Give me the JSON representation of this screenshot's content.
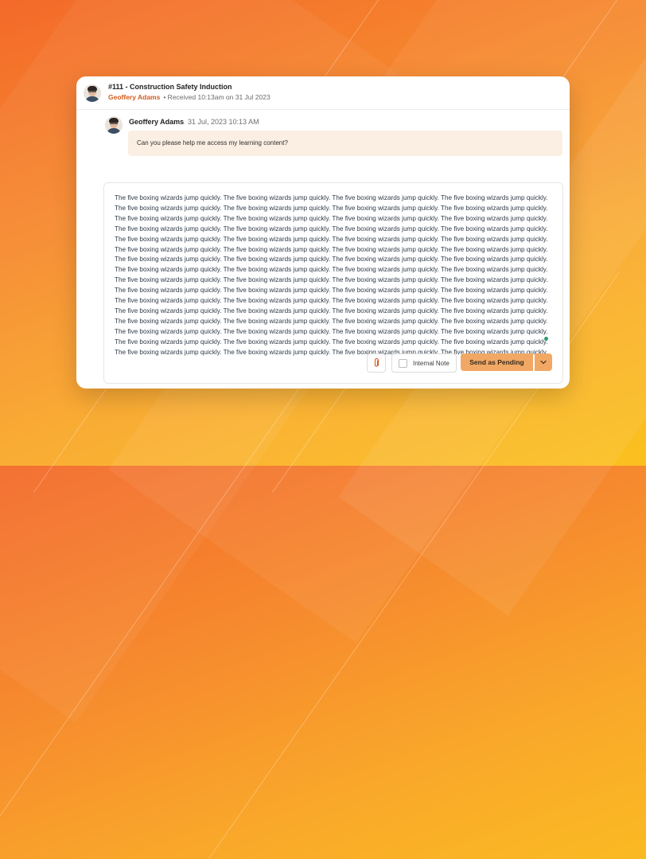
{
  "ticket": {
    "title": "#111 - Construction Safety Induction",
    "sender": "Geoffery Adams",
    "received": "• Received 10:13am on 31 Jul 2023"
  },
  "message": {
    "author": "Geoffery Adams",
    "time": "31 Jul, 2023 10:13 AM",
    "text": "Can you please help me access my learning content?"
  },
  "composer": {
    "text": "The five boxing wizards jump quickly. The five boxing wizards jump quickly. The five boxing wizards jump quickly. The five boxing wizards jump quickly. The five boxing wizards jump quickly. The five boxing wizards jump quickly. The five boxing wizards jump quickly. The five boxing wizards jump quickly. The five boxing wizards jump quickly. The five boxing wizards jump quickly. The five boxing wizards jump quickly. The five boxing wizards jump quickly. The five boxing wizards jump quickly. The five boxing wizards jump quickly. The five boxing wizards jump quickly. The five boxing wizards jump quickly. The five boxing wizards jump quickly. The five boxing wizards jump quickly. The five boxing wizards jump quickly. The five boxing wizards jump quickly. The five boxing wizards jump quickly. The five boxing wizards jump quickly. The five boxing wizards jump quickly. The five boxing wizards jump quickly. The five boxing wizards jump quickly. The five boxing wizards jump quickly. The five boxing wizards jump quickly. The five boxing wizards jump quickly. The five boxing wizards jump quickly. The five boxing wizards jump quickly. The five boxing wizards jump quickly. The five boxing wizards jump quickly. The five boxing wizards jump quickly. The five boxing wizards jump quickly. The five boxing wizards jump quickly. The five boxing wizards jump quickly. The five boxing wizards jump quickly. The five boxing wizards jump quickly. The five boxing wizards jump quickly. The five boxing wizards jump quickly. The five boxing wizards jump quickly. The five boxing wizards jump quickly. The five boxing wizards jump quickly. The five boxing wizards jump quickly. The five boxing wizards jump quickly. The five boxing wizards jump quickly. The five boxing wizards jump quickly. The five boxing wizards jump quickly. The five boxing wizards jump quickly. The five boxing wizards jump quickly. The five boxing wizards jump quickly. The five boxing wizards jump quickly. The five boxing wizards jump quickly. The five boxing wizards jump quickly. The five boxing wizards jump quickly. The five boxing wizards jump quickly. The five boxing wizards jump quickly. The five boxing wizards jump quickly. The five boxing wizards jump quickly. The five boxing wizards jump quickly. The five boxing wizards jump quickly. The five boxing wizards jump quickly. The five boxing wizards jump quickly. The five boxing wizards jump quickly.",
    "internal_note_label": "Internal Note",
    "internal_note_checked": false,
    "send_label": "Send as Pending"
  },
  "icons": {
    "attach": "paperclip-icon",
    "caret": "chevron-down-icon",
    "status": "online-dot-icon"
  },
  "colors": {
    "accent": "#f1a865",
    "sender_name": "#d45a1f",
    "message_bg": "#fbefe3",
    "status_dot": "#2f9b6f"
  }
}
